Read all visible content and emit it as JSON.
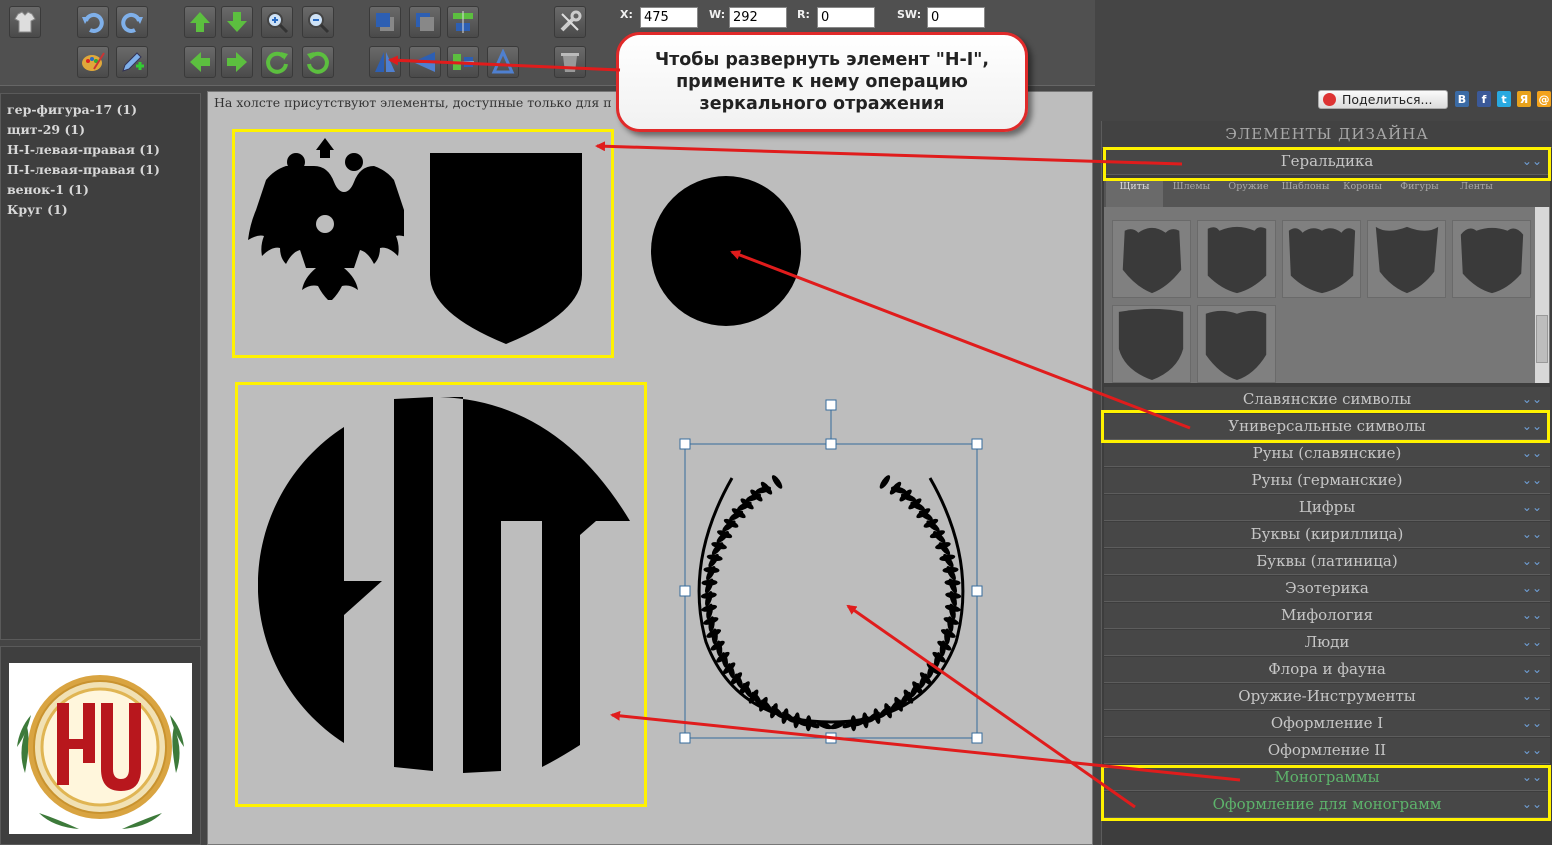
{
  "toolbar": {
    "buttons": [
      "shirt",
      "undo",
      "redo",
      "move-up",
      "move-down",
      "zoom-in",
      "zoom-out",
      "bring-front",
      "send-back",
      "align-center",
      "settings",
      "palette",
      "edit-add",
      "move-left",
      "move-right",
      "rotate-cw",
      "rotate-ccw",
      "mirror-h",
      "mirror-v",
      "align-middle",
      "flip-vertical",
      "delete"
    ],
    "x_label": "X:",
    "x_value": "475",
    "w_label": "W:",
    "w_value": "292",
    "r_label": "R:",
    "r_value": "0",
    "sw_label": "SW:",
    "sw_value": "0"
  },
  "layers": [
    "гер-фигура-17 (1)",
    "щит-29 (1)",
    "Н-I-левая-правая (1)",
    "П-I-левая-правая (1)",
    "венок-1 (1)",
    "Круг (1)"
  ],
  "canvas": {
    "notice": "На холсте присутствуют элементы, доступные только для п"
  },
  "callout": {
    "text": "Чтобы развернуть элемент \"Н-I\", примените к нему операцию зеркального отражения"
  },
  "share": {
    "label": "Поделиться...",
    "networks": [
      "В",
      "f",
      "t",
      "Я",
      "@"
    ]
  },
  "design_panel": {
    "title": "ЭЛЕМЕНТЫ ДИЗАЙНА",
    "subtabs": [
      "Щиты",
      "Шлемы",
      "Оружие",
      "Шаблоны",
      "Короны",
      "Фигуры",
      "Ленты"
    ],
    "categories": [
      "Геральдика",
      "Славянские символы",
      "Универсальные символы",
      "Руны (славянские)",
      "Руны (германские)",
      "Цифры",
      "Буквы (кириллица)",
      "Буквы (латиница)",
      "Эзотерика",
      "Мифология",
      "Люди",
      "Флора и фауна",
      "Оружие-Инструменты",
      "Оформление I",
      "Оформление II",
      "Монограммы",
      "Оформление для монограмм"
    ]
  },
  "colors": {
    "highlight": "#fff200",
    "arrow": "#e01c1c",
    "green_category": "#5db36b",
    "accent_chevron": "#6fa0d8"
  }
}
